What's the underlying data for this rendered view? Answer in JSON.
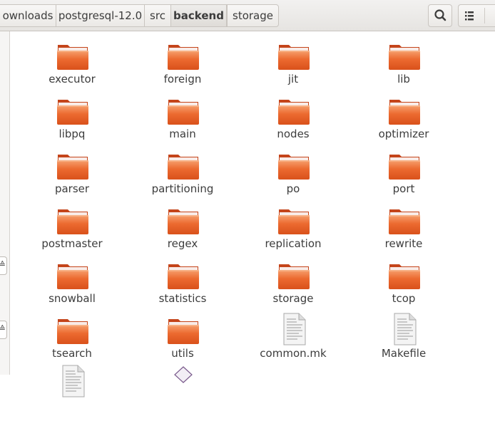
{
  "breadcrumbs": [
    "ownloads",
    "postgresql-12.0",
    "src",
    "backend",
    "storage"
  ],
  "active_crumb": "backend",
  "items": [
    {
      "name": "executor",
      "type": "folder"
    },
    {
      "name": "foreign",
      "type": "folder"
    },
    {
      "name": "jit",
      "type": "folder"
    },
    {
      "name": "lib",
      "type": "folder"
    },
    {
      "name": "libpq",
      "type": "folder"
    },
    {
      "name": "main",
      "type": "folder"
    },
    {
      "name": "nodes",
      "type": "folder"
    },
    {
      "name": "optimizer",
      "type": "folder"
    },
    {
      "name": "parser",
      "type": "folder"
    },
    {
      "name": "partitioning",
      "type": "folder"
    },
    {
      "name": "po",
      "type": "folder"
    },
    {
      "name": "port",
      "type": "folder"
    },
    {
      "name": "postmaster",
      "type": "folder"
    },
    {
      "name": "regex",
      "type": "folder"
    },
    {
      "name": "replication",
      "type": "folder"
    },
    {
      "name": "rewrite",
      "type": "folder"
    },
    {
      "name": "snowball",
      "type": "folder"
    },
    {
      "name": "statistics",
      "type": "folder"
    },
    {
      "name": "storage",
      "type": "folder"
    },
    {
      "name": "tcop",
      "type": "folder"
    },
    {
      "name": "tsearch",
      "type": "folder"
    },
    {
      "name": "utils",
      "type": "folder"
    },
    {
      "name": "common.mk",
      "type": "text-file"
    },
    {
      "name": "Makefile",
      "type": "text-file"
    },
    {
      "name": "",
      "type": "text-file"
    },
    {
      "name": "",
      "type": "other-file"
    }
  ],
  "icons": {
    "search": "search-icon",
    "view_list": "list-view-icon",
    "folder": "folder-icon",
    "text_file": "text-file-icon"
  },
  "colors": {
    "folder_top": "#f08d5a",
    "folder_body": "#e65a23",
    "text": "#3c3c3c"
  }
}
